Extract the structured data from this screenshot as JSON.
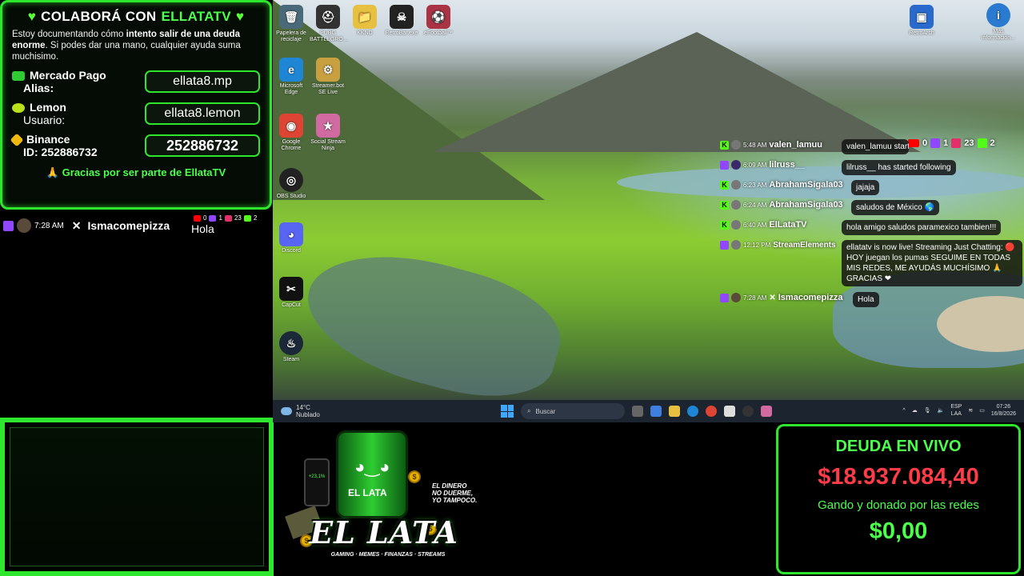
{
  "donate": {
    "title_prefix": "COLABORÁ CON",
    "title_highlight": "ELLATATV",
    "text_part1": "Estoy documentando cómo ",
    "text_bold": "intento salir de una deuda enorme",
    "text_part2": ". Si podes dar una mano, cualquier ayuda suma muchisimo.",
    "methods": [
      {
        "name": "Mercado Pago",
        "sub": "Alias:",
        "value": "ellata8.mp",
        "icon": "mercadopago-icon",
        "color": "#2ecc32"
      },
      {
        "name": "Lemon",
        "sub": "Usuario:",
        "value": "ellata8.lemon",
        "icon": "lemon-icon",
        "color": "#b9e21a"
      },
      {
        "name": "Binance",
        "sub": "ID: 252886732",
        "value": "252886732",
        "icon": "binance-icon",
        "color": "#f0b90b"
      }
    ],
    "footer": "🙏 Gracias por ser parte de EllataTV"
  },
  "left_chat": {
    "time": "7:28 AM",
    "user": "Ismacomepizza",
    "message": "Hola",
    "counts": {
      "youtube": "0",
      "twitch": "1",
      "instagram": "23",
      "kick": "2"
    }
  },
  "desktop_icons": [
    {
      "label": "Papelera de reciclaje",
      "glyph": "🗑",
      "bg": "#4a6a7a"
    },
    {
      "label": "PUBG BATTLEGRO...",
      "glyph": "⛑",
      "bg": "#333"
    },
    {
      "label": "KKND",
      "glyph": "📁",
      "bg": "#e8c040"
    },
    {
      "label": "RetroBar.exe",
      "glyph": "☠",
      "bg": "#222"
    },
    {
      "label": "eFootball™",
      "glyph": "⚽",
      "bg": "#aa3344"
    },
    {
      "label": "Microsoft Edge",
      "glyph": "e",
      "bg": "#1f86d6"
    },
    {
      "label": "Streamer.bot SE Live",
      "glyph": "⚙",
      "bg": "#c8a040"
    },
    {
      "label": "Google Chrome",
      "glyph": "◉",
      "bg": "#dd4433"
    },
    {
      "label": "Social Stream Ninja",
      "glyph": "★",
      "bg": "#d06aa0"
    },
    {
      "label": "OBS Studio",
      "glyph": "◎",
      "bg": "#222"
    },
    {
      "label": "Discord",
      "glyph": "◕",
      "bg": "#5865f2"
    },
    {
      "label": "CapCut",
      "glyph": "✂",
      "bg": "#111"
    },
    {
      "label": "Steam",
      "glyph": "♨",
      "bg": "#1b2838"
    },
    {
      "label": "RetroArch",
      "glyph": "▣",
      "bg": "#2a6acc"
    },
    {
      "label": "Más información...",
      "glyph": "i",
      "bg": "#2a7ad0"
    }
  ],
  "chat_overlay": [
    {
      "platform": "kick",
      "time": "5:48 AM",
      "user": "valen_lamuu",
      "message": "valen_lamuu started following"
    },
    {
      "platform": "twitch",
      "time": "6:09 AM",
      "user": "lilruss__",
      "message": "lilruss__ has started following"
    },
    {
      "platform": "kick",
      "time": "6:23 AM",
      "user": "AbrahamSigala03",
      "message": "jajaja"
    },
    {
      "platform": "kick",
      "time": "6:24 AM",
      "user": "AbrahamSigala03",
      "message": "saludos de México 🌎"
    },
    {
      "platform": "kick",
      "time": "6:40 AM",
      "user": "ElLataTV",
      "message": "hola amigo saludos paramexico tambien!!!"
    },
    {
      "platform": "twitch",
      "time": "12:12 PM",
      "user": "StreamElements",
      "message": "ellatatv is now live! Streaming Just Chatting: 🔴 HOY juegan los pumas SEGUIME EN TODAS MIS REDES, ME AYUDÁS MUCHÍSIMO 🙏 GRACIAS ❤"
    },
    {
      "platform": "twitch",
      "time": "7:28 AM",
      "user": "Ismacomepizza",
      "message": "Hola"
    }
  ],
  "overlay_counts": {
    "youtube": "0",
    "twitch": "1",
    "instagram": "23",
    "kick": "2"
  },
  "taskbar": {
    "temperature": "14°C",
    "weather": "Nublado",
    "search_placeholder": "Buscar",
    "lang": "ESP",
    "lang_sub": "LAA",
    "time": "07:26",
    "date": "16/8/2026"
  },
  "logo": {
    "title": "EL LATA",
    "subtitle": "GAMING · MEMES · FINANZAS · STREAMS",
    "tag1": "EL DINERO",
    "tag2": "NO DUERME,",
    "tag3": "YO TAMPOCO.",
    "can_label": "EL LATA",
    "phone_value": "+23,1%"
  },
  "debt": {
    "title": "DEUDA EN VIVO",
    "amount": "$18.937.084,40",
    "sub": "Gando y donado por las redes",
    "donated": "$0,00"
  },
  "colors": {
    "accent_green": "#2ee62e",
    "debt_red": "#ff3b48",
    "twitch": "#9146ff",
    "kick": "#53fc18"
  }
}
